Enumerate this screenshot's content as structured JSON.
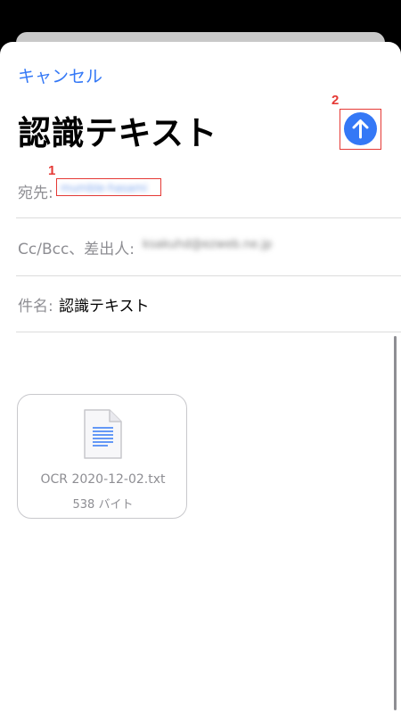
{
  "header": {
    "cancel_label": "キャンセル",
    "title": "認識テキスト"
  },
  "markers": {
    "one": "1",
    "two": "2"
  },
  "fields": {
    "to_label": "宛先:",
    "to_value": "mumble-hasami",
    "cc_label": "Cc/Bcc、差出人:",
    "cc_value": "ksakuhd@ezweb.ne.jp",
    "subject_label": "件名:",
    "subject_value": "認識テキスト"
  },
  "attachment": {
    "filename": "OCR 2020-12-02.txt",
    "size": "538 バイト",
    "icon": "text-document-icon"
  },
  "colors": {
    "accent": "#3478f6",
    "annotation": "#e53935",
    "secondary_text": "#8e8e93"
  }
}
